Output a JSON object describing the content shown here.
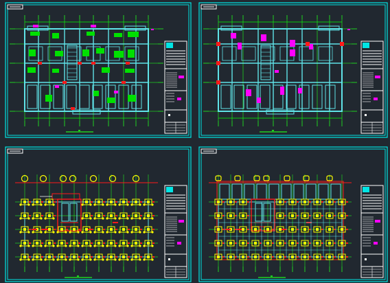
{
  "colors": {
    "background": "#212830",
    "frame": "#00e5e5",
    "wall": "#5fe3e8",
    "axis": "#20d020",
    "dimension": "#00ff00",
    "column": "#ff1a1a",
    "highlight": "#ff00ff",
    "title_block": "#ffffff",
    "yellow": "#ffff00",
    "green_fill": "#00e000"
  },
  "sheets": [
    {
      "id": "sheet-1",
      "kind": "floor-plan-green-tags"
    },
    {
      "id": "sheet-2",
      "kind": "floor-plan-magenta-tags"
    },
    {
      "id": "sheet-3",
      "kind": "foundation-plan"
    },
    {
      "id": "sheet-4",
      "kind": "foundation-plan-beams"
    }
  ]
}
